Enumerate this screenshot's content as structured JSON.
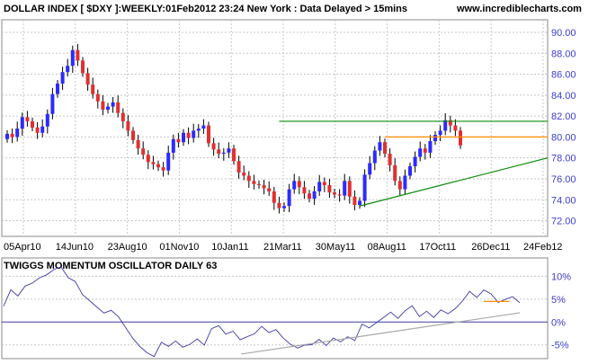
{
  "header": {
    "title": "DOLLAR INDEX [ $DXY ]:WEEKLY:01Feb2012 23:24 New York  : Data Delayed > 15mins",
    "site": "www.incrediblecharts.com"
  },
  "colors": {
    "up_candle": "#2b2bff",
    "down_candle": "#e03030",
    "grid": "#c8c8c8",
    "trend_green": "#0a8a0a",
    "trend_orange": "#ff8c00",
    "oscillator": "#3c3ca8",
    "osc_trend": "#a8a8a8",
    "zero_line": "#3c3ca8",
    "axis_text": "#3c3cd0"
  },
  "chart_data": [
    {
      "type": "candlestick",
      "title": "DOLLAR INDEX [ $DXY ]:WEEKLY:01Feb2012 23:24 New York  : Data Delayed > 15mins",
      "x_tick_labels": [
        "05Apr10",
        "14Jun10",
        "23Aug10",
        "01Nov10",
        "10Jan11",
        "21Mar11",
        "30May11",
        "08Aug11",
        "17Oct11",
        "26Dec11",
        "24Feb12"
      ],
      "y_tick_labels": [
        "72.00",
        "74.00",
        "76.00",
        "78.00",
        "80.00",
        "82.00",
        "84.00",
        "86.00",
        "88.00",
        "90.00"
      ],
      "ylim": [
        70.5,
        91.2
      ],
      "grid": true,
      "close": [
        80.3,
        80.0,
        80.8,
        81.9,
        81.5,
        80.9,
        80.4,
        81.0,
        82.2,
        84.1,
        85.1,
        86.2,
        86.8,
        88.3,
        87.3,
        86.1,
        85.0,
        84.1,
        83.4,
        82.6,
        82.9,
        83.3,
        82.3,
        81.5,
        80.6,
        79.7,
        78.9,
        78.3,
        77.6,
        77.4,
        77.1,
        76.8,
        78.5,
        79.8,
        79.5,
        80.4,
        79.9,
        80.6,
        80.8,
        81.1,
        79.4,
        78.8,
        78.4,
        78.5,
        78.9,
        77.7,
        76.6,
        76.3,
        75.8,
        75.5,
        75.4,
        75.1,
        74.8,
        73.7,
        73.2,
        73.4,
        75.0,
        75.8,
        75.2,
        74.6,
        74.1,
        74.8,
        75.7,
        75.4,
        74.7,
        74.5,
        74.4,
        75.8,
        74.3,
        73.5,
        73.9,
        76.4,
        77.5,
        78.7,
        79.5,
        78.4,
        77.3,
        75.8,
        75.0,
        76.3,
        77.2,
        78.1,
        78.9,
        78.5,
        79.6,
        80.2,
        80.6,
        81.6,
        81.1,
        80.6,
        79.2
      ],
      "annotations": [
        {
          "type": "trendline",
          "color": "green",
          "from": {
            "index": 54,
            "value": 81.5
          },
          "to": {
            "index": 94,
            "value": 81.5
          }
        },
        {
          "type": "trendline",
          "color": "green",
          "from": {
            "index": 70,
            "value": 73.4
          },
          "to": {
            "index": 94,
            "value": 78.0
          }
        },
        {
          "type": "trendline",
          "color": "orange",
          "from": {
            "index": 75,
            "value": 80.0
          },
          "to": {
            "index": 94,
            "value": 80.0
          }
        }
      ]
    },
    {
      "type": "line",
      "title": "TWIGGS MOMENTUM OSCILLATOR DAILY 63",
      "y_tick_labels": [
        "-5%",
        "0%",
        "5%",
        "10%"
      ],
      "ylim": [
        -8,
        14
      ],
      "grid": true,
      "series": [
        {
          "values": [
            4.5,
            6.0,
            5.0,
            7.5,
            8.5,
            10.0,
            11.0,
            12.5,
            11.0,
            9.0,
            8.5,
            6.0,
            5.0,
            4.0,
            3.0,
            1.5,
            0.5,
            -1.5,
            -3.5,
            -5.0,
            -6.0,
            -6.5,
            -5.5,
            -6.0,
            -4.5,
            -5.5,
            -4.5,
            -3.0,
            -4.0,
            -2.5,
            -1.5,
            -3.0,
            -2.0,
            -3.5,
            -2.5,
            -1.5,
            -2.0,
            -3.0,
            -2.0,
            -3.5,
            -4.5,
            -5.0,
            -4.0,
            -6.0,
            -4.5,
            -5.5,
            -3.5,
            -4.0,
            -2.5,
            -3.0,
            -1.5,
            -2.0,
            -0.5,
            1.0,
            2.5,
            1.5,
            3.5,
            2.5,
            0.5,
            2.0,
            1.0,
            3.0,
            2.5,
            4.0,
            3.5,
            6.0,
            5.0,
            7.0,
            6.5,
            5.0,
            6.0,
            4.5,
            3.5
          ]
        }
      ],
      "annotations": [
        {
          "type": "trendline",
          "color": "gray",
          "from": {
            "index": 0.46,
            "value": -7.0
          },
          "to": {
            "index": 1.0,
            "value": 2.0
          }
        },
        {
          "type": "trendline",
          "color": "orange",
          "from": {
            "index": 0.93,
            "value": 4.5
          },
          "to": {
            "index": 0.98,
            "value": 4.5
          }
        }
      ]
    }
  ]
}
